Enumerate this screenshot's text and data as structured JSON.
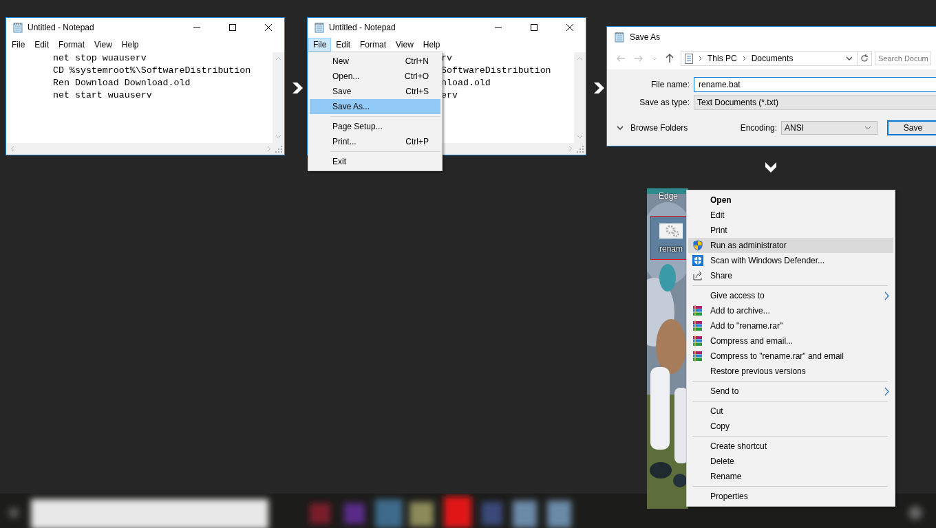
{
  "notepad_1": {
    "title": "Untitled - Notepad",
    "menu": [
      {
        "label": "File",
        "selected": false
      },
      {
        "label": "Edit",
        "selected": false
      },
      {
        "label": "Format",
        "selected": false
      },
      {
        "label": "View",
        "selected": false
      },
      {
        "label": "Help",
        "selected": false
      }
    ],
    "lines": [
      "net stop wuauserv",
      "CD %systemroot%\\SoftwareDistribution",
      "Ren Download Download.old",
      "net start wuauserv"
    ]
  },
  "notepad_2": {
    "title": "Untitled - Notepad",
    "menu": [
      {
        "label": "File",
        "selected": true
      },
      {
        "label": "Edit",
        "selected": false
      },
      {
        "label": "Format",
        "selected": false
      },
      {
        "label": "View",
        "selected": false
      },
      {
        "label": "Help",
        "selected": false
      }
    ],
    "lines": [
      "rv",
      "SoftwareDistribution",
      "nload.old",
      "erv"
    ]
  },
  "file_menu": [
    {
      "kind": "item",
      "label": "New",
      "shortcut": "Ctrl+N",
      "selected": false
    },
    {
      "kind": "item",
      "label": "Open...",
      "shortcut": "Ctrl+O",
      "selected": false
    },
    {
      "kind": "item",
      "label": "Save",
      "shortcut": "Ctrl+S",
      "selected": false
    },
    {
      "kind": "item",
      "label": "Save As...",
      "selected": true
    },
    {
      "kind": "separator"
    },
    {
      "kind": "item",
      "label": "Page Setup...",
      "selected": false
    },
    {
      "kind": "item",
      "label": "Print...",
      "shortcut": "Ctrl+P",
      "selected": false
    },
    {
      "kind": "separator"
    },
    {
      "kind": "item",
      "label": "Exit",
      "selected": false
    }
  ],
  "save_as": {
    "title": "Save As",
    "path": [
      "This PC",
      "Documents"
    ],
    "search": {
      "placeholder": "Search Docum"
    },
    "fields": [
      {
        "kind": "input",
        "label": "File name:",
        "value": "rename.bat"
      },
      {
        "kind": "select",
        "label": "Save as type:",
        "value": "Text Documents (*.txt)"
      }
    ],
    "browse_folders": "Browse Folders",
    "encoding": {
      "label": "Encoding:",
      "value": "ANSI"
    },
    "button": "Save"
  },
  "desktop": {
    "edge_label": "Edge",
    "selected_icon": {
      "label": "renam",
      "highlighted": true
    }
  },
  "context_menu": [
    {
      "kind": "plain",
      "label": "Open",
      "bold": true,
      "submenu": false,
      "selected": false
    },
    {
      "kind": "plain",
      "label": "Edit",
      "bold": false,
      "submenu": false,
      "selected": false
    },
    {
      "kind": "plain",
      "label": "Print",
      "bold": false,
      "submenu": false,
      "selected": false
    },
    {
      "kind": "shield",
      "label": "Run as administrator",
      "bold": false,
      "submenu": false,
      "selected": true
    },
    {
      "kind": "defender",
      "label": "Scan with Windows Defender...",
      "bold": false,
      "submenu": false,
      "selected": false
    },
    {
      "kind": "share",
      "label": "Share",
      "bold": false,
      "submenu": false,
      "selected": false
    },
    {
      "kind": "separator"
    },
    {
      "kind": "plain",
      "label": "Give access to",
      "bold": false,
      "submenu": true,
      "selected": false
    },
    {
      "kind": "archive",
      "label": "Add to archive...",
      "bold": false,
      "submenu": false,
      "selected": false
    },
    {
      "kind": "archive",
      "label": "Add to \"rename.rar\"",
      "bold": false,
      "submenu": false,
      "selected": false
    },
    {
      "kind": "archive",
      "label": "Compress and email...",
      "bold": false,
      "submenu": false,
      "selected": false
    },
    {
      "kind": "archive",
      "label": "Compress to \"rename.rar\" and email",
      "bold": false,
      "submenu": false,
      "selected": false
    },
    {
      "kind": "plain",
      "label": "Restore previous versions",
      "bold": false,
      "submenu": false,
      "selected": false
    },
    {
      "kind": "separator"
    },
    {
      "kind": "plain",
      "label": "Send to",
      "bold": false,
      "submenu": true,
      "selected": false
    },
    {
      "kind": "separator"
    },
    {
      "kind": "plain",
      "label": "Cut",
      "bold": false,
      "submenu": false,
      "selected": false
    },
    {
      "kind": "plain",
      "label": "Copy",
      "bold": false,
      "submenu": false,
      "selected": false
    },
    {
      "kind": "separator"
    },
    {
      "kind": "plain",
      "label": "Create shortcut",
      "bold": false,
      "submenu": false,
      "selected": false
    },
    {
      "kind": "plain",
      "label": "Delete",
      "bold": false,
      "submenu": false,
      "selected": false
    },
    {
      "kind": "plain",
      "label": "Rename",
      "bold": false,
      "submenu": false,
      "selected": false
    },
    {
      "kind": "separator"
    },
    {
      "kind": "plain",
      "label": "Properties",
      "bold": false,
      "submenu": false,
      "selected": false
    }
  ]
}
